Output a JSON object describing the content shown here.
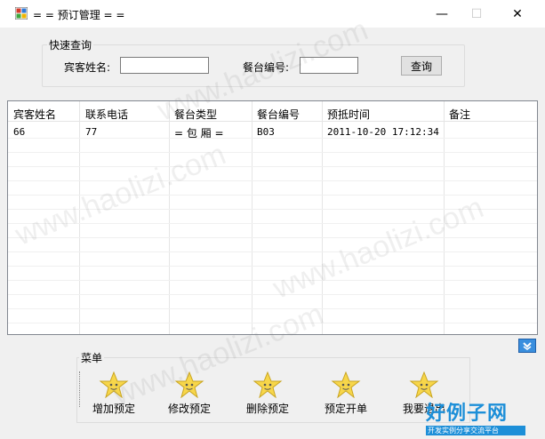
{
  "window": {
    "title": "= = 预订管理 = =",
    "minimize_glyph": "—",
    "maximize_glyph": "☐",
    "close_glyph": "✕"
  },
  "search": {
    "group_title": "快速查询",
    "guest_name_label": "宾客姓名:",
    "guest_name_value": "",
    "table_no_label": "餐台编号:",
    "table_no_value": "",
    "query_button": "查询"
  },
  "grid": {
    "columns": [
      "宾客姓名",
      "联系电话",
      "餐台类型",
      "餐台编号",
      "预抵时间",
      "备注"
    ],
    "rows": [
      [
        "66",
        "77",
        "= 包 厢 =",
        "B03",
        "2011-10-20 17:12:34",
        ""
      ]
    ]
  },
  "menu": {
    "group_title": "菜单",
    "items": [
      {
        "label": "增加预定",
        "icon": "star-face-icon"
      },
      {
        "label": "修改预定",
        "icon": "star-face-icon"
      },
      {
        "label": "删除预定",
        "icon": "star-face-icon"
      },
      {
        "label": "预定开单",
        "icon": "star-face-icon"
      },
      {
        "label": "我要退出",
        "icon": "star-face-icon"
      }
    ]
  },
  "watermark": {
    "text": "www.haolizi.com"
  },
  "brand": {
    "logo_text": "好例子网",
    "logo_tagline": "开发实例分享交流平台"
  },
  "colors": {
    "accent": "#1d8fd8",
    "star": "#f7d64a"
  }
}
